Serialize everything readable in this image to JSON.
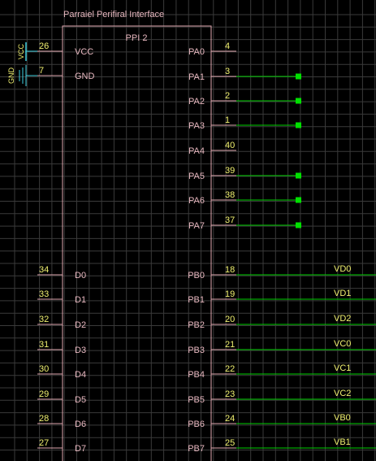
{
  "colors": {
    "background": "#000000",
    "grid": "#3a3a3a",
    "chip_outline": "#e0a8b0",
    "chip_text": "#e8b8c0",
    "pin_number": "#f0f070",
    "pin_line": "#e0a8b0",
    "wire": "#00d000",
    "wire_end": "#00e000",
    "net_label": "#f0f070",
    "power_symbol": "#40d0e0",
    "power_label": "#f0f070"
  },
  "chip": {
    "title": "Parraiel Perifiral Interface",
    "name": "PPI 2"
  },
  "left_pins": [
    {
      "num": "26",
      "name": "VCC"
    },
    {
      "num": "7",
      "name": "GND"
    },
    {
      "num": "34",
      "name": "D0"
    },
    {
      "num": "33",
      "name": "D1"
    },
    {
      "num": "32",
      "name": "D2"
    },
    {
      "num": "31",
      "name": "D3"
    },
    {
      "num": "30",
      "name": "D4"
    },
    {
      "num": "29",
      "name": "D5"
    },
    {
      "num": "28",
      "name": "D6"
    },
    {
      "num": "27",
      "name": "D7"
    }
  ],
  "right_pins": [
    {
      "num": "4",
      "name": "PA0",
      "wire": "none",
      "net": ""
    },
    {
      "num": "3",
      "name": "PA1",
      "wire": "short",
      "net": ""
    },
    {
      "num": "2",
      "name": "PA2",
      "wire": "short",
      "net": ""
    },
    {
      "num": "1",
      "name": "PA3",
      "wire": "short",
      "net": ""
    },
    {
      "num": "40",
      "name": "PA4",
      "wire": "none",
      "net": ""
    },
    {
      "num": "39",
      "name": "PA5",
      "wire": "short",
      "net": ""
    },
    {
      "num": "38",
      "name": "PA6",
      "wire": "short",
      "net": ""
    },
    {
      "num": "37",
      "name": "PA7",
      "wire": "short",
      "net": ""
    },
    {
      "num": "18",
      "name": "PB0",
      "wire": "long",
      "net": "VD0"
    },
    {
      "num": "19",
      "name": "PB1",
      "wire": "long",
      "net": "VD1"
    },
    {
      "num": "20",
      "name": "PB2",
      "wire": "long",
      "net": "VD2"
    },
    {
      "num": "21",
      "name": "PB3",
      "wire": "long",
      "net": "VC0"
    },
    {
      "num": "22",
      "name": "PB4",
      "wire": "long",
      "net": "VC1"
    },
    {
      "num": "23",
      "name": "PB5",
      "wire": "long",
      "net": "VC2"
    },
    {
      "num": "24",
      "name": "PB6",
      "wire": "long",
      "net": "VB0"
    },
    {
      "num": "25",
      "name": "PB7",
      "wire": "long",
      "net": "VB1"
    }
  ],
  "power": [
    {
      "label": "VCC",
      "symbol": "vcc-symbol-icon"
    },
    {
      "label": "GND",
      "symbol": "ground-symbol-icon"
    }
  ]
}
